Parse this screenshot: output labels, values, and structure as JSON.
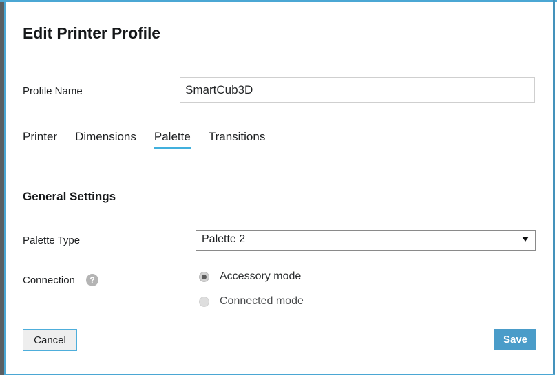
{
  "dialog": {
    "title": "Edit Printer Profile",
    "accent_color": "#41b0dd",
    "save_button_color": "#4a9cc9"
  },
  "profile_name": {
    "label": "Profile Name",
    "value": "SmartCub3D",
    "placeholder": ""
  },
  "tabs": [
    {
      "label": "Printer",
      "active": false
    },
    {
      "label": "Dimensions",
      "active": false
    },
    {
      "label": "Palette",
      "active": true
    },
    {
      "label": "Transitions",
      "active": false
    }
  ],
  "general_settings": {
    "heading": "General Settings",
    "palette_type": {
      "label": "Palette Type",
      "selected": "Palette 2",
      "arrow_icon": "chevron-down-icon"
    },
    "connection": {
      "label": "Connection",
      "help_icon": "help-icon",
      "help_icon_glyph": "?",
      "options": [
        {
          "label": "Accessory mode",
          "selected": true
        },
        {
          "label": "Connected mode",
          "selected": false
        }
      ]
    }
  },
  "footer": {
    "cancel_label": "Cancel",
    "save_label": "Save"
  }
}
